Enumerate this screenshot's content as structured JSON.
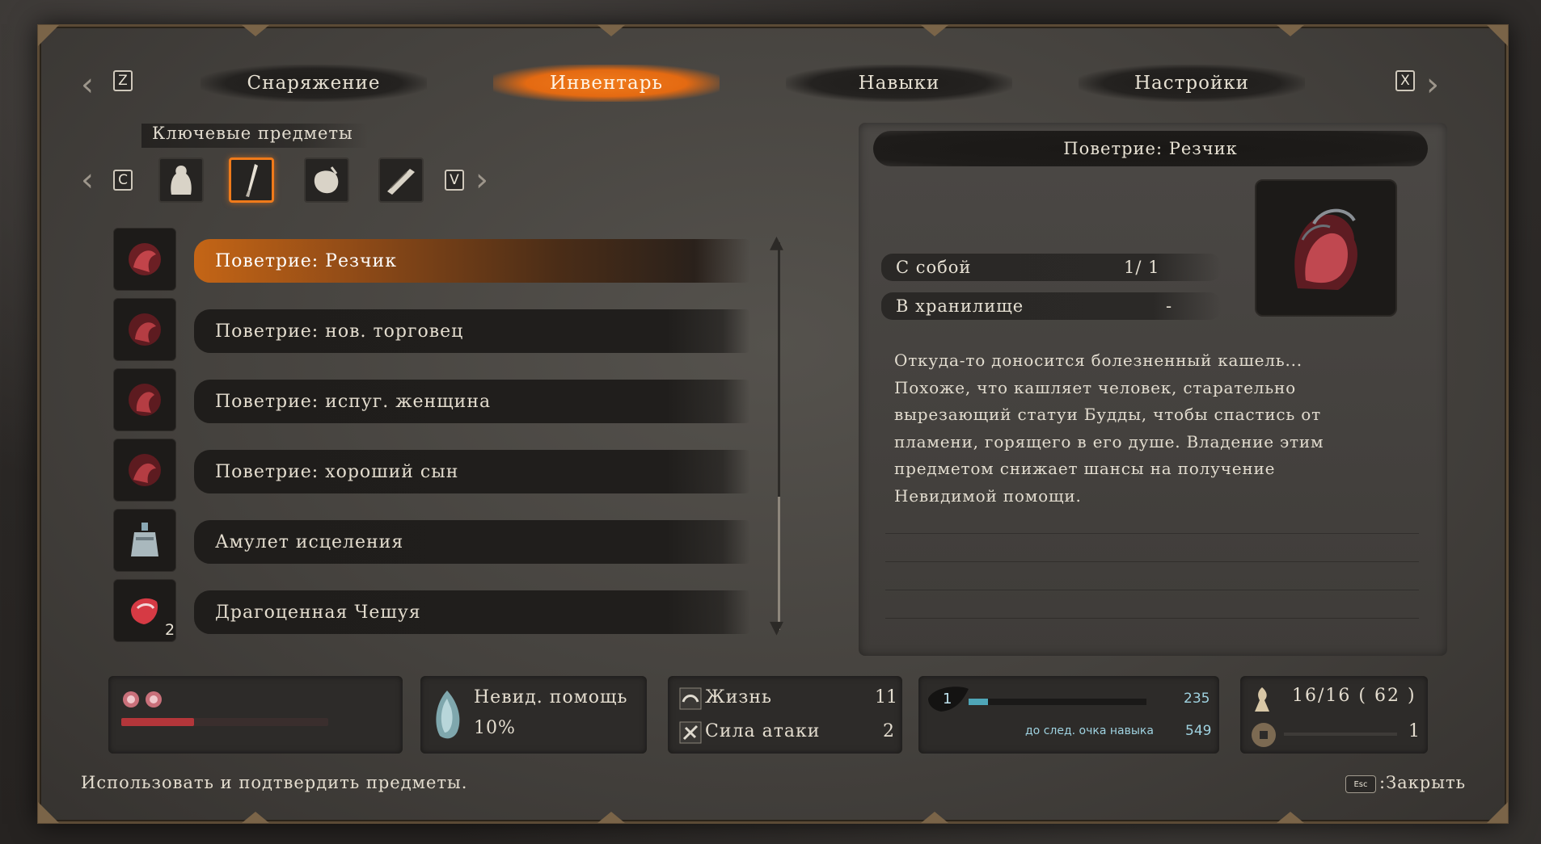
{
  "tabs": {
    "left_key": "Z",
    "right_key": "X",
    "items": [
      {
        "label": "Снаряжение"
      },
      {
        "label": "Инвентарь"
      },
      {
        "label": "Навыки"
      },
      {
        "label": "Настройки"
      }
    ],
    "active_index": 1
  },
  "category": {
    "title": "Ключевые предметы",
    "left_key": "C",
    "right_key": "V",
    "icons": [
      "figurine-icon",
      "carving-knife-icon",
      "pouch-icon",
      "scroll-icon"
    ],
    "active_index": 1
  },
  "items": [
    {
      "label": "Поветрие: Резчик",
      "icon": "rot-essence-icon",
      "count": ""
    },
    {
      "label": "Поветрие: нов. торговец",
      "icon": "rot-essence-icon",
      "count": ""
    },
    {
      "label": "Поветрие: испуг. женщина",
      "icon": "rot-essence-icon",
      "count": ""
    },
    {
      "label": "Поветрие: хороший сын",
      "icon": "rot-essence-icon",
      "count": ""
    },
    {
      "label": "Амулет исцеления",
      "icon": "healing-charm-icon",
      "count": ""
    },
    {
      "label": "Драгоценная Чешуя",
      "icon": "treasured-scale-icon",
      "count": "2"
    }
  ],
  "detail": {
    "title": "Поветрие: Резчик",
    "held_label": "С собой",
    "held_value": "1/  1",
    "storage_label": "В хранилище",
    "storage_value": "-",
    "description": [
      "Откуда-то доносится болезненный кашель...",
      "Похоже, что кашляет человек, старательно",
      "вырезающий статуи Будды, чтобы спастись от",
      "пламени, горящего в его душе. Владение этим",
      "предметом снижает шансы на получение",
      "Невидимой помощи."
    ]
  },
  "hud": {
    "unseen_aid_label": "Невид. помощь",
    "unseen_aid_value": "10%",
    "vitality_label": "Жизнь",
    "vitality_value": "11",
    "attack_label": "Сила атаки",
    "attack_value": "2",
    "skill_points": "1",
    "skill_exp": "235",
    "skill_exp_progress": 0.11,
    "next_point_label": "до след. очка навыка",
    "next_point_value": "549",
    "spirit_emblems": "16/16  ( 62 )",
    "sen": "1",
    "health_progress": 0.35
  },
  "footer": {
    "hint": "Использовать и подтвердить предметы.",
    "esc_key": "Esc",
    "close_label": ":Закрыть"
  },
  "colors": {
    "accent_orange": "#f07a1a",
    "panel_dark": "#1f1d1b",
    "frame_bronze": "#7a6448",
    "teal": "#4fa6b8",
    "health_red": "#b3363a"
  }
}
